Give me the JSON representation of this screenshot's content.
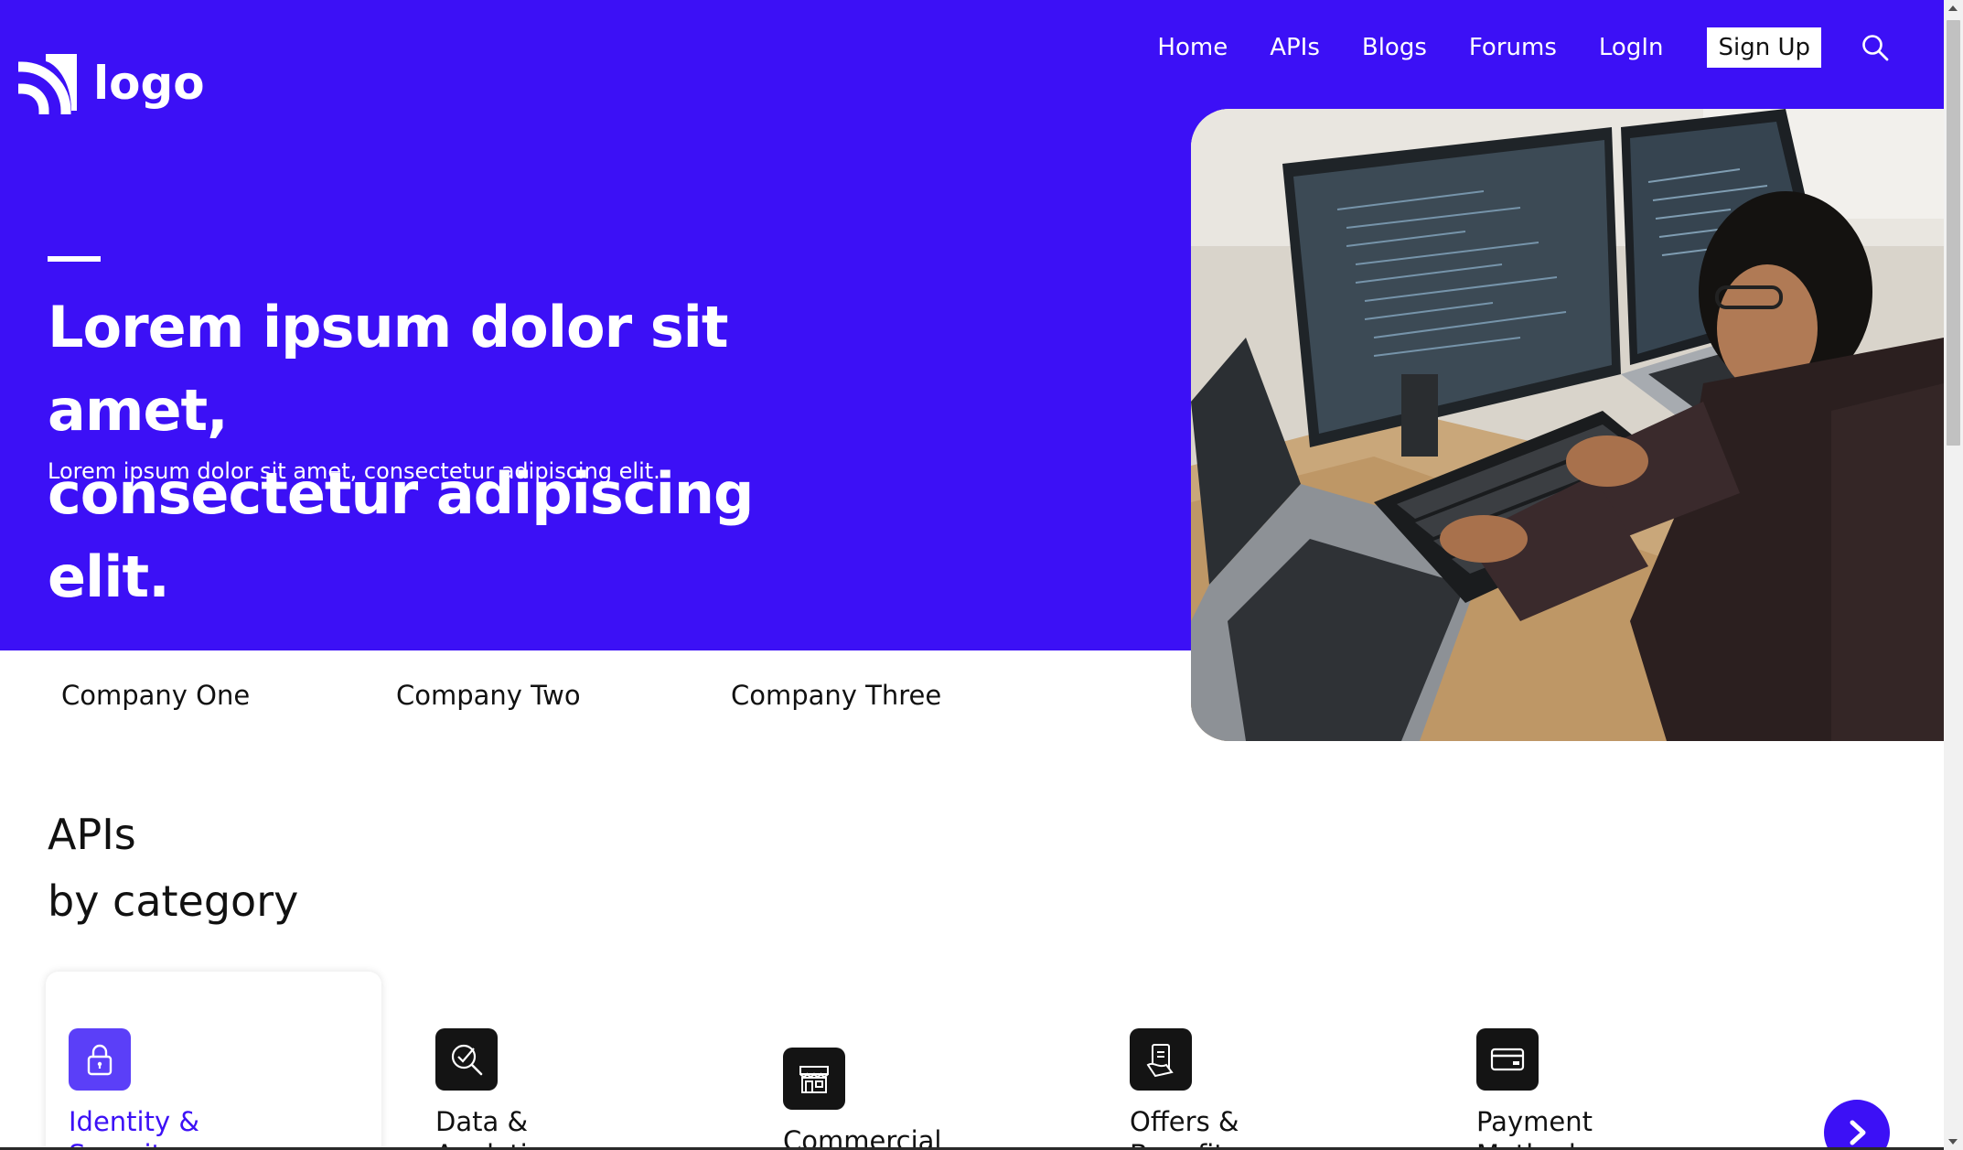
{
  "brand": {
    "logo_text": "logo"
  },
  "nav": {
    "items": [
      {
        "label": "Home"
      },
      {
        "label": "APIs"
      },
      {
        "label": "Blogs"
      },
      {
        "label": "Forums"
      },
      {
        "label": "LogIn"
      }
    ],
    "signup_label": "Sign Up",
    "search_icon": "search-icon"
  },
  "hero": {
    "title_line1": "Lorem ipsum dolor sit amet,",
    "title_line2": "consectetur adipiscing elit.",
    "subtitle": "Lorem ipsum dolor sit amet, consectetur adipiscing elit."
  },
  "companies": [
    {
      "name": "Company One"
    },
    {
      "name": "Company Two"
    },
    {
      "name": "Company Three"
    }
  ],
  "apis_section": {
    "title_line1": "APIs",
    "title_line2": "by category"
  },
  "categories": [
    {
      "label": "Identity & Security",
      "icon": "lock-icon",
      "active": true
    },
    {
      "label": "Data & Analytics",
      "icon": "analytics-icon",
      "active": false
    },
    {
      "label": "Commercial",
      "icon": "store-icon",
      "active": false
    },
    {
      "label": "Offers & Benefits",
      "icon": "offers-icon",
      "active": false
    },
    {
      "label": "Payment Methods",
      "icon": "card-icon",
      "active": false
    }
  ],
  "carousel": {
    "next_icon": "chevron-right-icon"
  },
  "colors": {
    "brand_primary": "#3c10f6",
    "active_icon_bg": "#5b3ff8",
    "icon_bg": "#141414",
    "text_dark": "#111111",
    "white": "#ffffff"
  }
}
